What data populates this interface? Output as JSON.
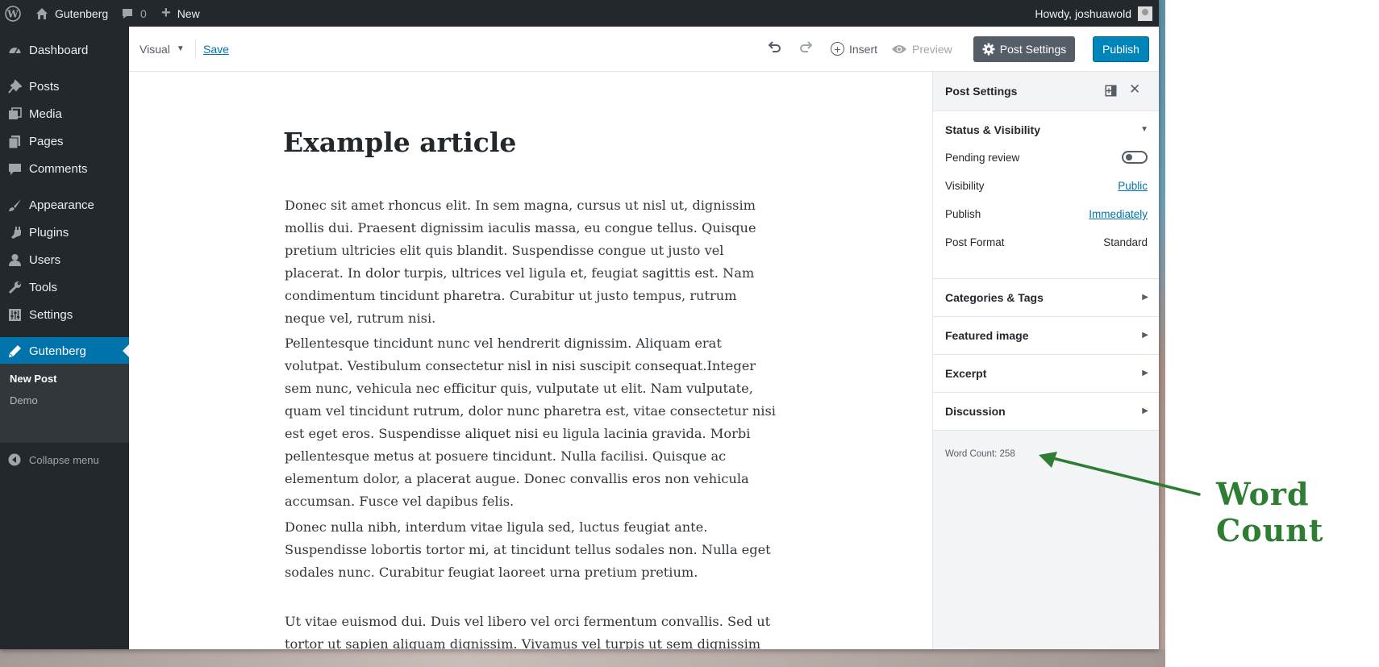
{
  "admin_bar": {
    "site_name": "Gutenberg",
    "comments_count": "0",
    "new_label": "New",
    "howdy": "Howdy, joshuawold"
  },
  "sidebar": {
    "items": [
      {
        "label": "Dashboard",
        "icon": "dashboard-icon"
      },
      {
        "label": "Posts",
        "icon": "pin-icon"
      },
      {
        "label": "Media",
        "icon": "media-icon"
      },
      {
        "label": "Pages",
        "icon": "pages-icon"
      },
      {
        "label": "Comments",
        "icon": "comments-icon"
      },
      {
        "label": "Appearance",
        "icon": "brush-icon"
      },
      {
        "label": "Plugins",
        "icon": "plugin-icon"
      },
      {
        "label": "Users",
        "icon": "user-icon"
      },
      {
        "label": "Tools",
        "icon": "wrench-icon"
      },
      {
        "label": "Settings",
        "icon": "settings-icon"
      },
      {
        "label": "Gutenberg",
        "icon": "pencil-icon"
      }
    ],
    "submenu": [
      "New Post",
      "Demo"
    ],
    "collapse_label": "Collapse menu"
  },
  "toolbar": {
    "mode_label": "Visual",
    "save_label": "Save",
    "insert_label": "Insert",
    "preview_label": "Preview",
    "post_settings_label": "Post Settings",
    "publish_label": "Publish"
  },
  "post": {
    "title": "Example article",
    "paragraphs": [
      "Donec sit amet rhoncus elit. In sem magna, cursus ut nisl ut, dignissim mollis dui. Praesent dignissim iaculis massa, eu congue tellus. Quisque pretium ultricies elit quis blandit. Suspendisse congue ut justo vel placerat. In dolor turpis, ultrices vel ligula et, feugiat sagittis est. Nam condimentum tincidunt pharetra. Curabitur ut justo tempus, rutrum neque vel, rutrum nisi.",
      "Pellentesque tincidunt nunc vel hendrerit dignissim. Aliquam erat volutpat. Vestibulum consectetur nisl in nisi suscipit consequat.Integer sem nunc, vehicula nec efficitur quis, vulputate ut elit. Nam vulputate, quam vel tincidunt rutrum, dolor nunc pharetra est, vitae consectetur nisi est eget eros. Suspendisse aliquet nisi eu ligula lacinia gravida. Morbi pellentesque metus at posuere tincidunt. Nulla facilisi. Quisque ac elementum dolor, a placerat augue. Donec convallis eros non vehicula accumsan. Fusce vel dapibus felis.",
      "Donec nulla nibh, interdum vitae ligula sed, luctus feugiat ante. Suspendisse lobortis tortor mi, at tincidunt tellus sodales non. Nulla eget sodales nunc. Curabitur feugiat laoreet urna pretium pretium.",
      "Ut vitae euismod dui. Duis vel libero vel orci fermentum convallis. Sed ut tortor ut sapien aliquam dignissim. Vivamus vel turpis ut sem dignissim commodo."
    ]
  },
  "inspector": {
    "title": "Post Settings",
    "status_panel": {
      "title": "Status & Visibility",
      "pending_label": "Pending review",
      "visibility_label": "Visibility",
      "visibility_value": "Public",
      "publish_label": "Publish",
      "publish_value": "Immediately",
      "format_label": "Post Format",
      "format_value": "Standard"
    },
    "panels": [
      "Categories & Tags",
      "Featured image",
      "Excerpt",
      "Discussion"
    ],
    "word_count": "Word Count: 258"
  },
  "annotation": {
    "label": "Word Count",
    "color": "#2e7d32"
  },
  "colors": {
    "admin_bar": "#23282d",
    "accent": "#0073aa",
    "publish_button": "#0085ba"
  }
}
